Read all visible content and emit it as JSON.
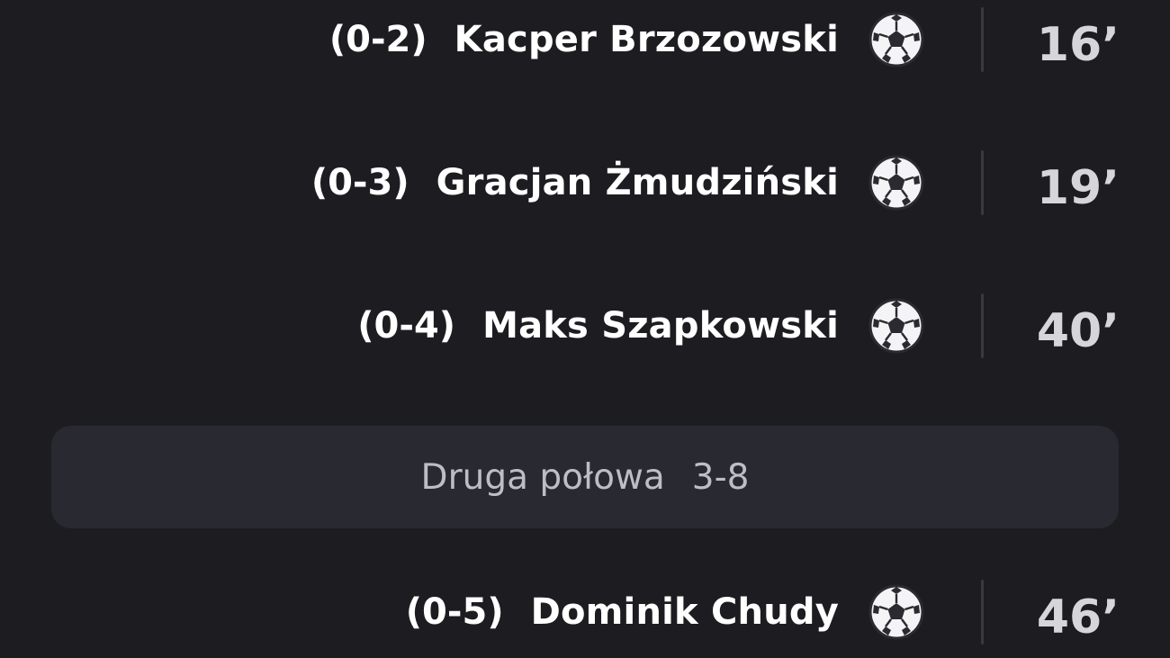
{
  "events": [
    {
      "score": "(0-2)",
      "player": "Kacper Brzozowski",
      "minute": "16’",
      "icon": "soccer-ball-icon"
    },
    {
      "score": "(0-3)",
      "player": "Gracjan Żmudziński",
      "minute": "19’",
      "icon": "soccer-ball-icon"
    },
    {
      "score": "(0-4)",
      "player": "Maks Szapkowski",
      "minute": "40’",
      "icon": "soccer-ball-icon"
    }
  ],
  "half_banner": {
    "label": "Druga połowa",
    "score": "3-8"
  },
  "events_second_half": [
    {
      "score": "(0-5)",
      "player": "Dominik Chudy",
      "minute": "46’",
      "icon": "soccer-ball-icon"
    }
  ],
  "colors": {
    "background": "#1d1c21",
    "banner": "#292931",
    "text_primary": "#ffffff",
    "text_secondary": "#bdbdc4",
    "divider": "#3a3940"
  }
}
